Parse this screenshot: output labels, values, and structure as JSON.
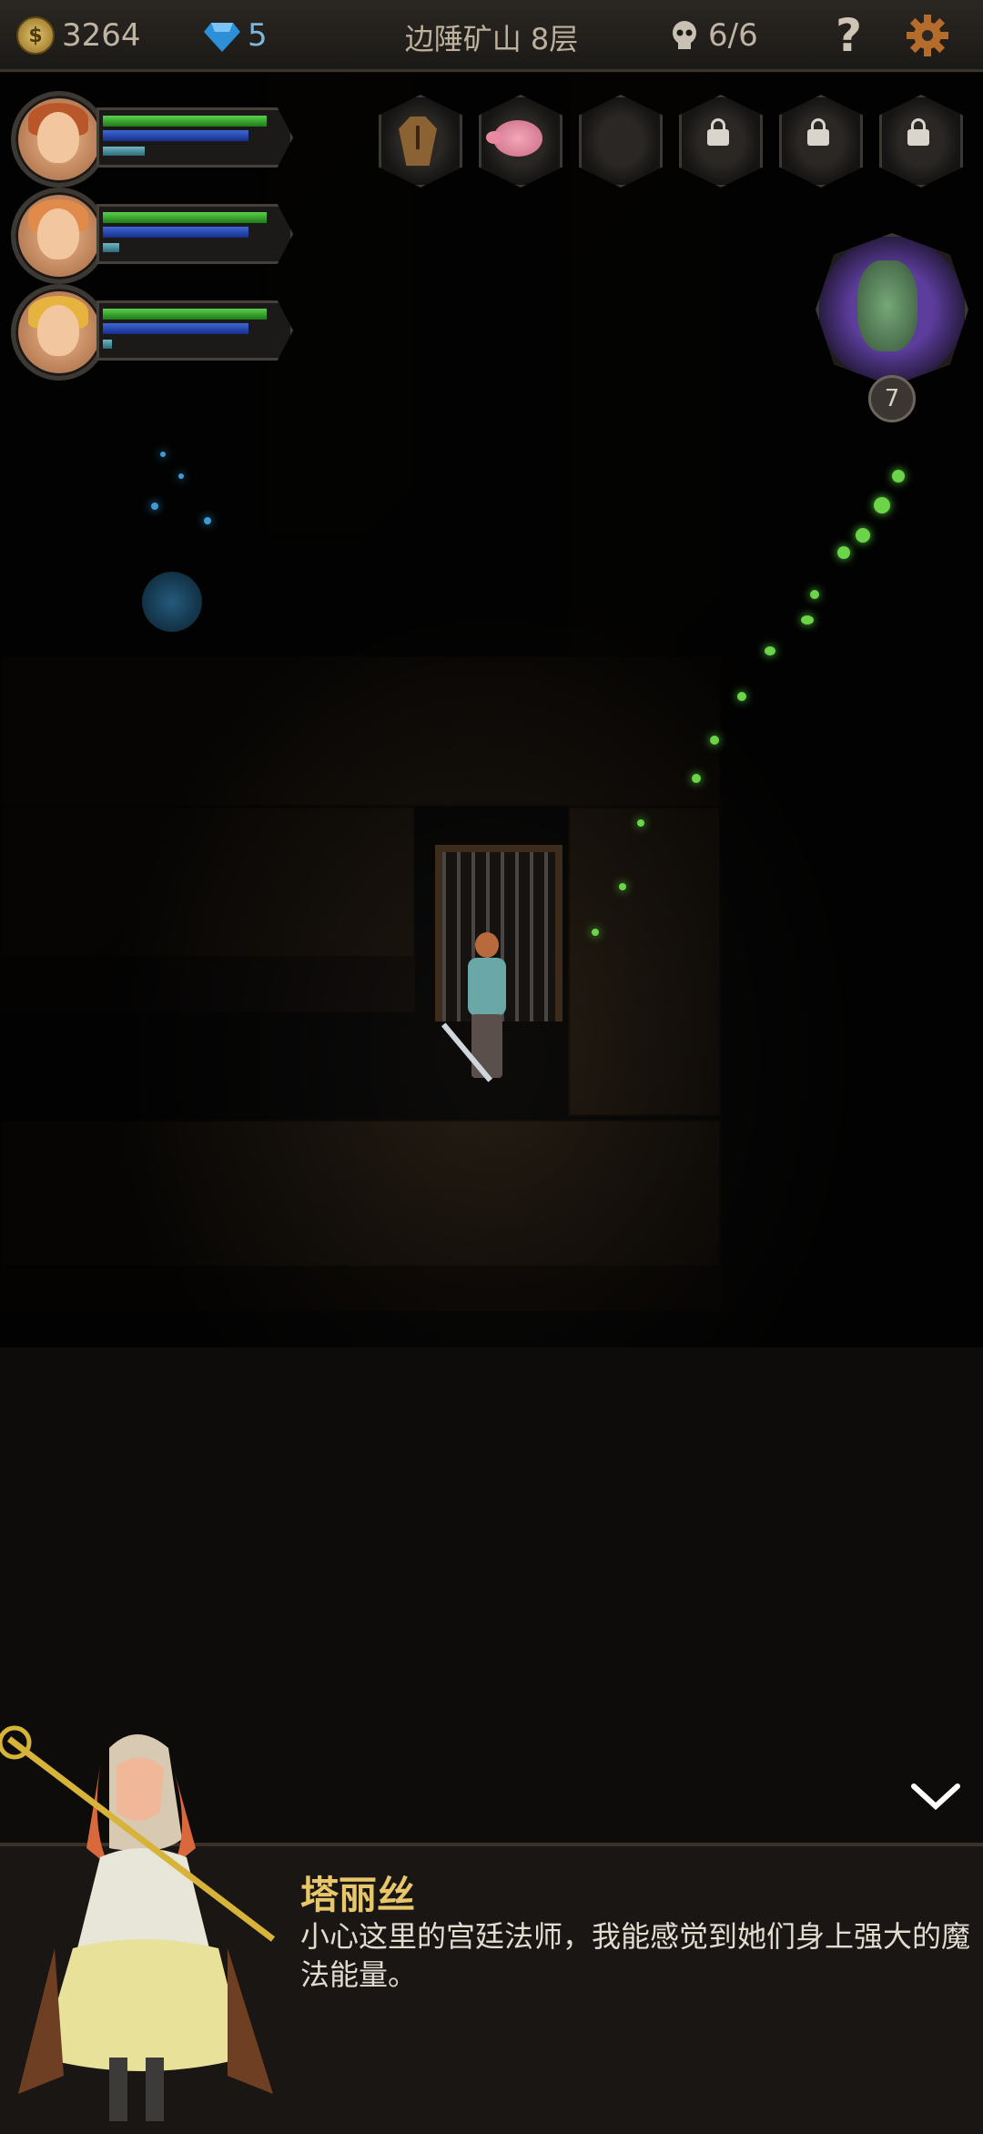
{
  "topbar": {
    "gold_icon_glyph": "$",
    "gold": "3264",
    "gems": "5",
    "location": "边陲矿山 8层",
    "kills": "6/6",
    "help_glyph": "?"
  },
  "party": [
    {
      "name": "hero-1",
      "hp": 0.95,
      "mp": 0.85,
      "xp": 0.3,
      "hair_color": "#b9562a"
    },
    {
      "name": "hero-2",
      "hp": 0.95,
      "mp": 0.85,
      "xp": 0.1,
      "hair_color": "#e08a4c"
    },
    {
      "name": "hero-3",
      "hp": 0.95,
      "mp": 0.85,
      "xp": 0.05,
      "hair_color": "#e7b33f"
    }
  ],
  "slots": [
    {
      "icon": "coffin-icon",
      "locked": false
    },
    {
      "icon": "piggy-bank-icon",
      "locked": false
    },
    {
      "icon": "empty",
      "locked": false
    },
    {
      "icon": "lock-icon",
      "locked": true
    },
    {
      "icon": "lock-icon",
      "locked": true
    },
    {
      "icon": "lock-icon",
      "locked": true
    }
  ],
  "fairy": {
    "count": "7"
  },
  "dialog": {
    "speaker": "塔丽丝",
    "text": "小心这里的宫廷法师，我能感觉到她们身上强大的魔法能量。"
  },
  "colors": {
    "gold": "#e7c76a",
    "hp": "#5bd04a",
    "mp": "#3e66d6",
    "spark": "#6bd448"
  }
}
